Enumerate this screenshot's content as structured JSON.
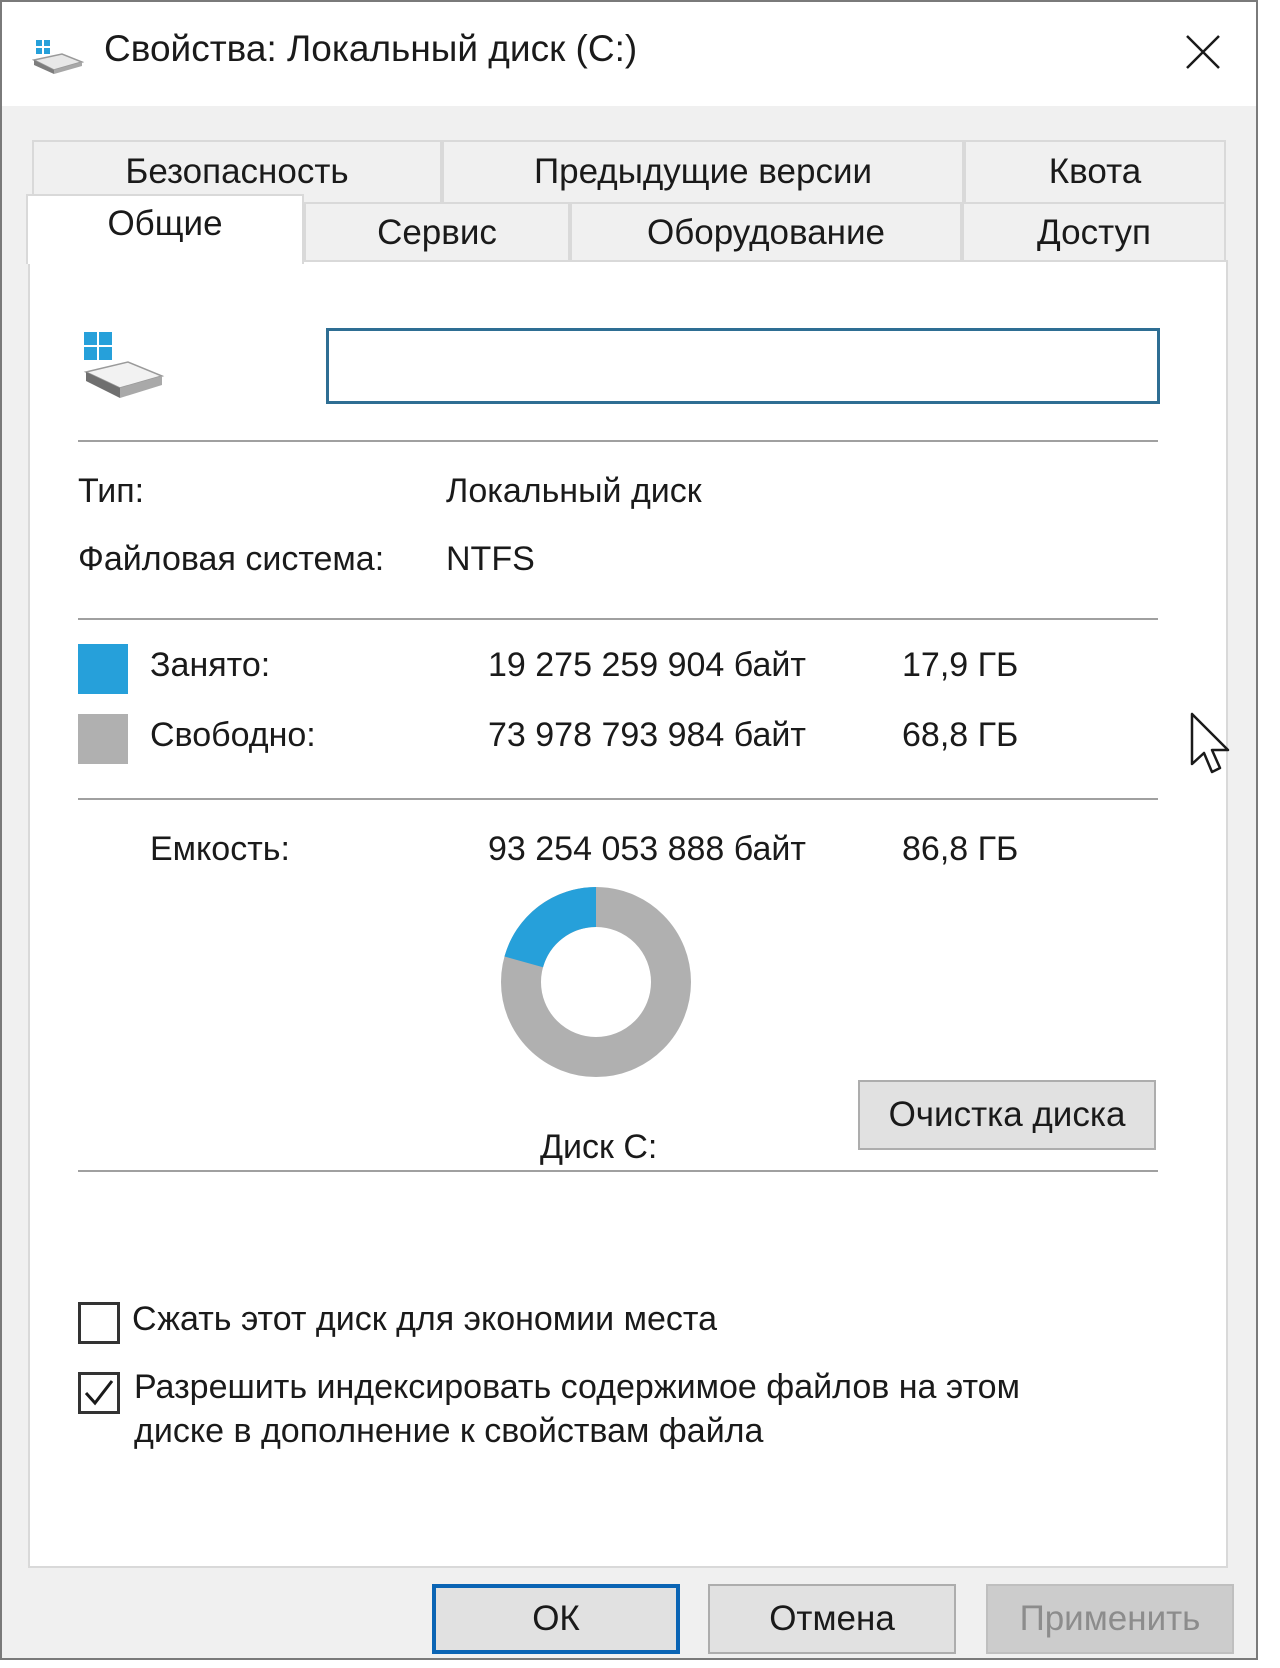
{
  "window": {
    "title": "Свойства: Локальный диск (C:)",
    "close_glyph": "✕"
  },
  "tabs": {
    "row1": [
      "Безопасность",
      "Предыдущие версии",
      "Квота"
    ],
    "row2": [
      "Общие",
      "Сервис",
      "Оборудование",
      "Доступ"
    ],
    "active": "Общие"
  },
  "general": {
    "drive_name_value": "",
    "type_label": "Тип:",
    "type_value": "Локальный диск",
    "fs_label": "Файловая система:",
    "fs_value": "NTFS",
    "used": {
      "label": "Занято:",
      "bytes": "19 275 259 904 байт",
      "size": "17,9 ГБ",
      "color": "#26a0da"
    },
    "free": {
      "label": "Свободно:",
      "bytes": "73 978 793 984 байт",
      "size": "68,8 ГБ",
      "color": "#b0b0b0"
    },
    "capacity": {
      "label": "Емкость:",
      "bytes": "93 254 053 888 байт",
      "size": "86,8 ГБ"
    },
    "used_fraction": 0.2067,
    "disk_label": "Диск C:",
    "cleanup_button": "Очистка диска",
    "compress_label": "Сжать этот диск для экономии места",
    "compress_checked": false,
    "index_label_line1": "Разрешить индексировать содержимое файлов на этом",
    "index_label_line2": "диске в дополнение к свойствам файла",
    "index_checked": true
  },
  "buttons": {
    "ok": "ОК",
    "cancel": "Отмена",
    "apply": "Применить"
  },
  "icons": {
    "title": "drive-icon",
    "drive": "windows-drive-icon",
    "close": "close-icon",
    "cursor": "mouse-pointer-icon"
  }
}
